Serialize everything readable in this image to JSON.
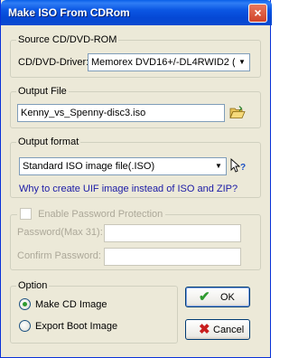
{
  "window": {
    "title": "Make ISO From CDRom",
    "close_glyph": "×"
  },
  "source": {
    "group_label": "Source CD/DVD-ROM",
    "driver_label": "CD/DVD-Driver:",
    "driver_value": "Memorex DVD16+/-DL4RWID2 ("
  },
  "output_file": {
    "group_label": "Output File",
    "path_value": "Kenny_vs_Spenny-disc3.iso"
  },
  "output_format": {
    "group_label": "Output format",
    "format_value": "Standard ISO image file(.ISO)",
    "help_link": "Why to create UIF image instead of ISO and ZIP?"
  },
  "password": {
    "enable_label": "Enable Password Protection",
    "password_label": "Password(Max 31):",
    "confirm_label": "Confirm Password:",
    "password_value": "",
    "confirm_value": ""
  },
  "option": {
    "group_label": "Option",
    "make_cd_label": "Make CD Image",
    "export_boot_label": "Export Boot Image",
    "selected": "Make CD Image"
  },
  "buttons": {
    "ok_label": "OK",
    "cancel_label": "Cancel",
    "ok_icon": "check-icon",
    "cancel_icon": "x-icon"
  },
  "colors": {
    "titlebar": "#0b56e3",
    "link": "#1a1aa6",
    "ok_check": "#2e9a2e",
    "cancel_x": "#c81e1e"
  }
}
